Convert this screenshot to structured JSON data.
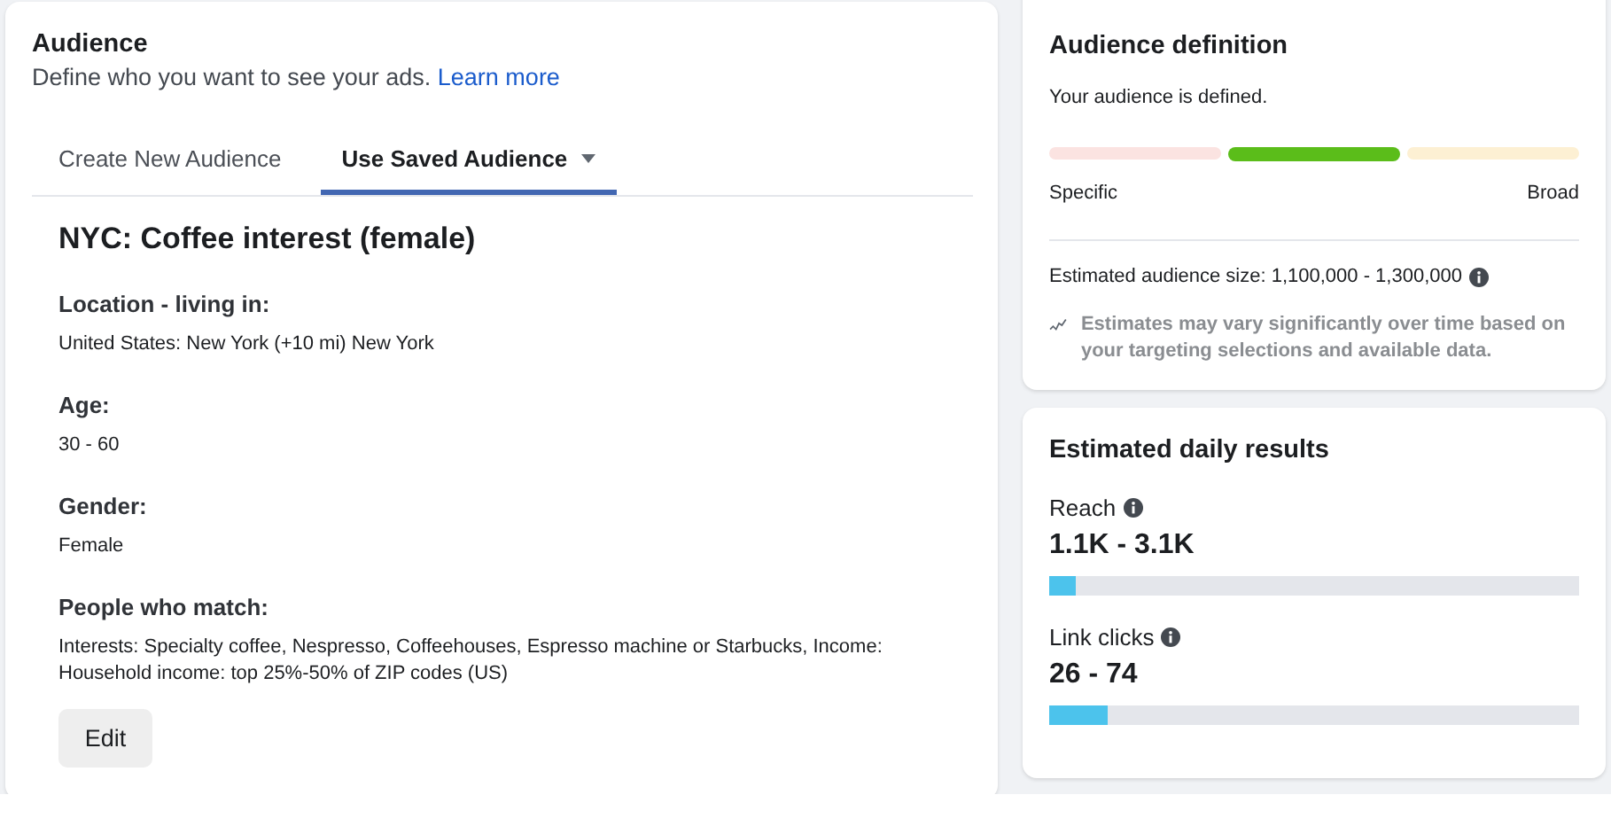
{
  "audience": {
    "title": "Audience",
    "description": "Define who you want to see your ads.",
    "learn_more": "Learn more",
    "tabs": [
      {
        "label": "Create New Audience",
        "selected": false,
        "dropdown": false
      },
      {
        "label": "Use Saved Audience",
        "selected": true,
        "dropdown": true
      }
    ],
    "saved_name": "NYC: Coffee interest (female)",
    "sections": [
      {
        "heading": "Location - living in:",
        "value": "United States: New York (+10 mi) New York"
      },
      {
        "heading": "Age:",
        "value": "30 - 60"
      },
      {
        "heading": "Gender:",
        "value": "Female"
      },
      {
        "heading": "People who match:",
        "value": "Interests: Specialty coffee, Nespresso, Coffeehouses, Espresso machine or Starbucks, Income: Household income: top 25%-50% of ZIP codes (US)"
      }
    ],
    "edit_button": "Edit"
  },
  "definition": {
    "title": "Audience definition",
    "status": "Your audience is defined.",
    "meter": [
      {
        "selected": false,
        "color": "#fbe3e1"
      },
      {
        "selected": true,
        "color": "#5bbd1a"
      },
      {
        "selected": false,
        "color": "#fdf0d3"
      }
    ],
    "left_label": "Specific",
    "right_label": "Broad",
    "size": "Estimated audience size: 1,100,000 - 1,300,000",
    "note": "Estimates may vary significantly over time based on your targeting selections and available data."
  },
  "results": {
    "title": "Estimated daily results",
    "metrics": [
      {
        "label": "Reach",
        "value": "1.1K - 3.1K",
        "level": 0.05
      },
      {
        "label": "Link clicks",
        "value": "26 - 74",
        "level": 0.11
      }
    ]
  }
}
